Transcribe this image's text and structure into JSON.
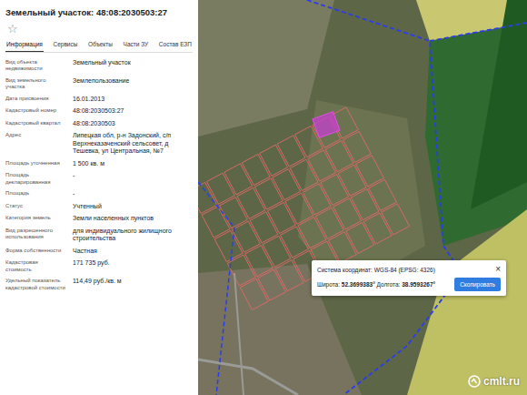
{
  "header": {
    "title": "Земельный участок: 48:08:2030503:27",
    "star": "☆"
  },
  "tabs": [
    {
      "label": "Информация",
      "selected": true
    },
    {
      "label": "Сервисы",
      "selected": false
    },
    {
      "label": "Объекты",
      "selected": false
    },
    {
      "label": "Части ЗУ",
      "selected": false
    },
    {
      "label": "Состав ЕЗП",
      "selected": false
    }
  ],
  "properties": [
    {
      "label": "Вид объекта недвижимости",
      "value": "Земельный участок"
    },
    {
      "label": "Вид земельного участка",
      "value": "Землепользование"
    },
    {
      "label": "Дата присвоения",
      "value": "16.01.2013"
    },
    {
      "label": "Кадастровый номер",
      "value": "48:08:2030503:27"
    },
    {
      "label": "Кадастровый квартал",
      "value": "48:08:2030503"
    },
    {
      "label": "Адрес",
      "value": "Липецкая обл, р-н Задонский, с/п Верхнеказаченский сельсовет, д Тешевка, ул Центральная, №7"
    },
    {
      "label": "Площадь уточненная",
      "value": "1 500 кв. м"
    },
    {
      "label": "Площадь декларированная",
      "value": "-"
    },
    {
      "label": "Площадь",
      "value": "-"
    },
    {
      "label": "Статус",
      "value": "Учтенный"
    },
    {
      "label": "Категория земель",
      "value": "Земли населенных пунктов"
    },
    {
      "label": "Вид разрешенного использования",
      "value": "для индивидуального жилищного строительства"
    },
    {
      "label": "Форма собственности",
      "value": "Частная"
    },
    {
      "label": "Кадастровая стоимость",
      "value": "171 735 руб."
    },
    {
      "label": "Удельный показатель кадастровой стоимости",
      "value": "114,49 руб./кв. м"
    }
  ],
  "map": {
    "watermark": "cmlt.ru"
  },
  "coordinate_popup": {
    "system_label": "Система координат:",
    "system_value": "WGS-84 (EPSG: 4326)",
    "close": "×",
    "latitude_label": "Широта:",
    "latitude": "52.3699383°",
    "longitude_label": "Долгота:",
    "longitude": "38.9593267°",
    "copy_button": "Скопировать"
  }
}
